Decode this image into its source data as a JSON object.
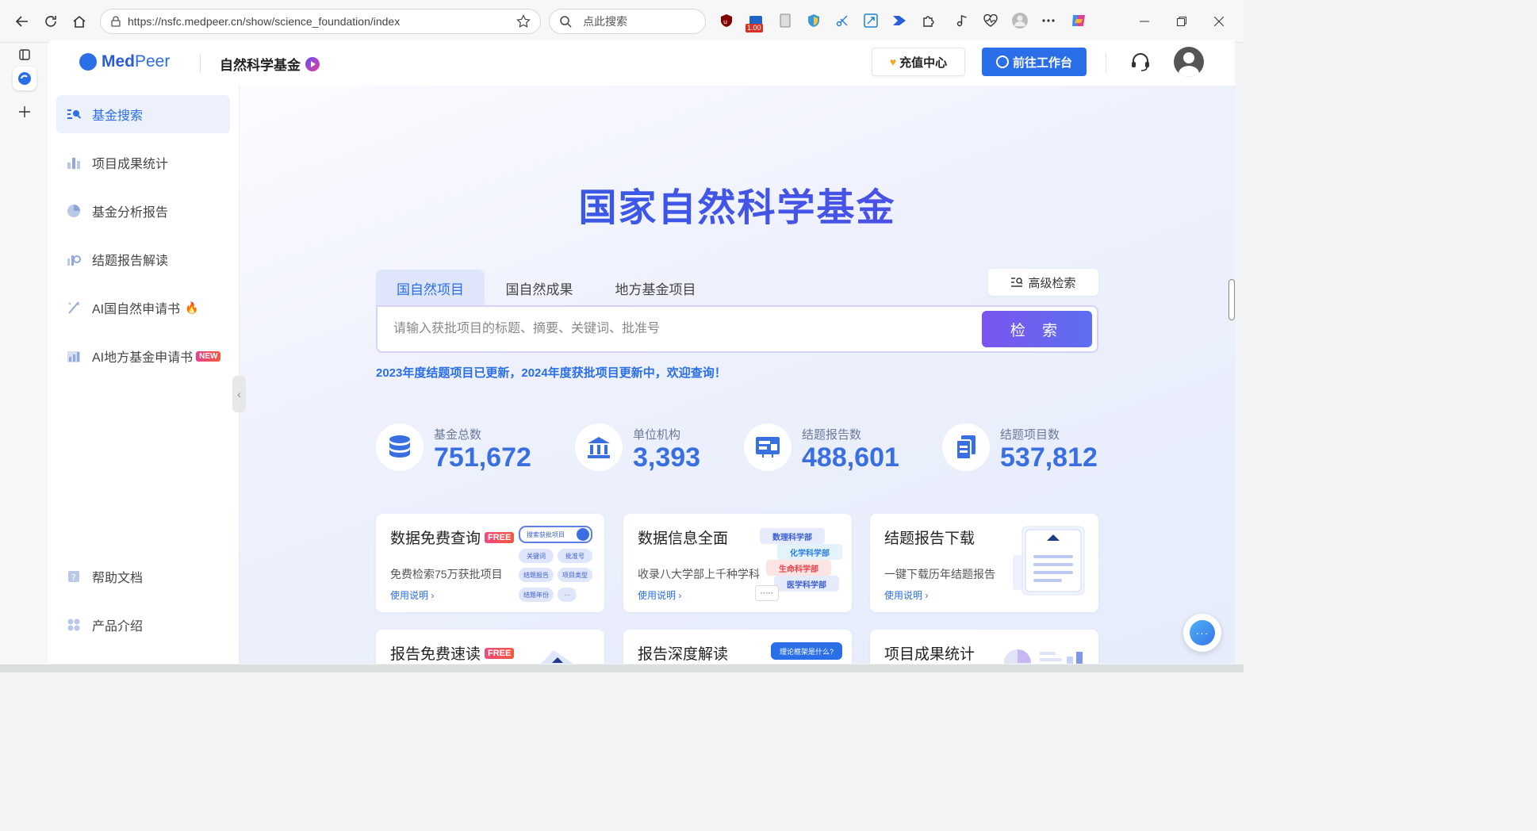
{
  "browser": {
    "url": "https://nsfc.medpeer.cn/show/science_foundation/index",
    "search_placeholder": "点此搜索",
    "ext_badge": "1.00",
    "extensions": [
      "ublock-icon",
      "video-ext-icon",
      "reader-icon",
      "shield-ext-icon",
      "scissors-icon",
      "translate-icon",
      "arrow-ext-icon",
      "puzzle-icon",
      "music-icon",
      "heart-rate-icon",
      "profile-icon",
      "more-icon",
      "copilot-icon"
    ]
  },
  "header": {
    "logo_med": "Med",
    "logo_peer": "Peer",
    "site_title": "自然科学基金",
    "recharge_label": "充值中心",
    "workspace_label": "前往工作台"
  },
  "sidebar": {
    "items": [
      {
        "label": "基金搜索",
        "icon": "fund-search-icon"
      },
      {
        "label": "项目成果统计",
        "icon": "bar-chart-icon"
      },
      {
        "label": "基金分析报告",
        "icon": "pie-chart-icon"
      },
      {
        "label": "结题报告解读",
        "icon": "report-chart-icon"
      },
      {
        "label": "AI国自然申请书",
        "icon": "ai-pen-icon"
      },
      {
        "label": "AI地方基金申请书",
        "icon": "ai-chart-icon",
        "badge": "NEW"
      },
      {
        "label": "帮助文档",
        "icon": "help-icon"
      },
      {
        "label": "产品介绍",
        "icon": "grid-icon"
      }
    ]
  },
  "main": {
    "hero_title": "国家自然科学基金",
    "tabs": [
      "国自然项目",
      "国自然成果",
      "地方基金项目"
    ],
    "advanced_search_label": "高级检索",
    "search_placeholder": "请输入获批项目的标题、摘要、关键词、批准号",
    "search_button": "检 索",
    "notice": "2023年度结题项目已更新，2024年度获批项目更新中，欢迎查询！",
    "stats": [
      {
        "label": "基金总数",
        "value": "751,672",
        "icon": "database-icon"
      },
      {
        "label": "单位机构",
        "value": "3,393",
        "icon": "institution-icon"
      },
      {
        "label": "结题报告数",
        "value": "488,601",
        "icon": "report-icon"
      },
      {
        "label": "结题项目数",
        "value": "537,812",
        "icon": "documents-icon"
      }
    ],
    "cards": [
      {
        "title": "数据免费查询",
        "badge": "FREE",
        "desc": "免费检索75万获批项目",
        "link": "使用说明"
      },
      {
        "title": "数据信息全面",
        "desc": "收录八大学部上千种学科",
        "link": "使用说明"
      },
      {
        "title": "结题报告下载",
        "desc": "一键下载历年结题报告",
        "link": "使用说明"
      },
      {
        "title": "报告免费速读",
        "badge": "FREE"
      },
      {
        "title": "报告深度解读"
      },
      {
        "title": "项目成果统计"
      }
    ],
    "card1_chips": [
      "搜索获批项目",
      "关键词",
      "批准号",
      "结题报告",
      "项目类型",
      "结题年份",
      "···"
    ],
    "card2_depts": [
      "数理科学部",
      "化学科学部",
      "生命科学部",
      "医学科学部",
      "·····"
    ],
    "card5_chip": "理论框架是什么?"
  },
  "colors": {
    "accent": "#2a6ee8",
    "hero_gradient": [
      "#2a5ee6",
      "#5a4ce6"
    ],
    "search_button": [
      "#7b55f0",
      "#5d6ff0"
    ],
    "badge_red": "#f14a7c"
  }
}
